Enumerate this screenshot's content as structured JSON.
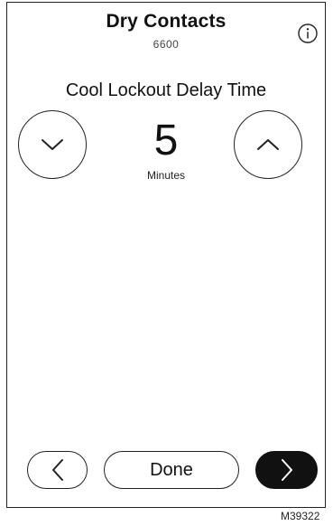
{
  "header": {
    "title": "Dry Contacts",
    "subtitle": "6600"
  },
  "setting": {
    "label": "Cool Lockout Delay Time",
    "value": "5",
    "unit": "Minutes"
  },
  "buttons": {
    "done_label": "Done"
  },
  "icons": {
    "info": "info-icon",
    "decrease": "chevron-down-icon",
    "increase": "chevron-up-icon",
    "back": "chevron-left-icon",
    "next": "chevron-right-icon"
  },
  "colors": {
    "outline": "#222222",
    "next_button_fill": "#111111",
    "next_button_icon": "#ffffff"
  },
  "figure_code": "M39322"
}
